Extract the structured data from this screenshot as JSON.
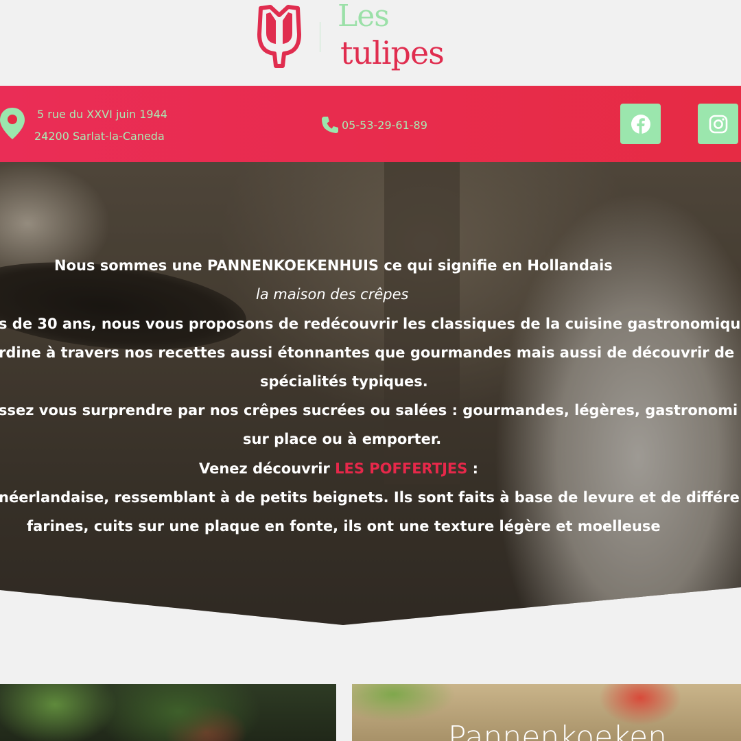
{
  "brand": {
    "name_line1": "Les",
    "name_line2": "tulipes",
    "colors": {
      "primary": "#e62b44",
      "accent_green": "#9be6ad"
    }
  },
  "contact": {
    "address_line1": "5 rue du XXVI juin 1944",
    "address_line2": "24200 Sarlat-la-Caneda",
    "phone": "05-53-29-61-89",
    "icons": {
      "address": "map-pin-icon",
      "phone": "phone-icon"
    }
  },
  "social": {
    "facebook_icon": "facebook-icon",
    "instagram_icon": "instagram-icon"
  },
  "hero": {
    "line1": "Nous sommes une PANNENKOEKENHUIS ce qui signifie en Hollandais",
    "line2": "la maison des crêpes",
    "line3": "s de 30 ans, nous vous proposons de redécouvrir les classiques de la cuisine gastronomiqu",
    "line4": "rdine à travers nos recettes aussi étonnantes que gourmandes mais aussi de découvrir de",
    "line5": "spécialités typiques.",
    "line6": "ssez vous surprendre par nos crêpes sucrées ou salées : gourmandes, légères, gastronomi",
    "line7": "sur place ou à emporter.",
    "line8_before": "Venez découvrir ",
    "line8_accent": "LES POFFERTJES",
    "line8_after": " :",
    "line9": "néerlandaise, ressemblant à de petits beignets. Ils sont faits à base de levure et de différe",
    "line10": "farines, cuits sur une plaque en fonte, ils ont une texture légère et moelleuse"
  },
  "cards": {
    "right_title": "Pannenkoeken"
  }
}
